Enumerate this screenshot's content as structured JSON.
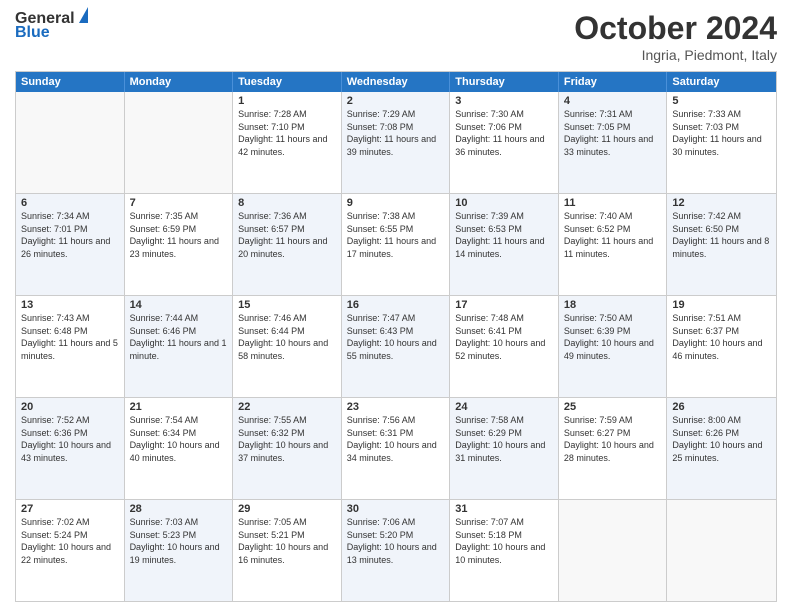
{
  "header": {
    "logo_line1": "General",
    "logo_line2": "Blue",
    "title": "October 2024",
    "subtitle": "Ingria, Piedmont, Italy"
  },
  "calendar": {
    "days": [
      "Sunday",
      "Monday",
      "Tuesday",
      "Wednesday",
      "Thursday",
      "Friday",
      "Saturday"
    ],
    "weeks": [
      [
        {
          "day": "",
          "sunrise": "",
          "sunset": "",
          "daylight": "",
          "empty": true
        },
        {
          "day": "",
          "sunrise": "",
          "sunset": "",
          "daylight": "",
          "empty": true
        },
        {
          "day": "1",
          "sunrise": "Sunrise: 7:28 AM",
          "sunset": "Sunset: 7:10 PM",
          "daylight": "Daylight: 11 hours and 42 minutes.",
          "empty": false,
          "alt": false
        },
        {
          "day": "2",
          "sunrise": "Sunrise: 7:29 AM",
          "sunset": "Sunset: 7:08 PM",
          "daylight": "Daylight: 11 hours and 39 minutes.",
          "empty": false,
          "alt": true
        },
        {
          "day": "3",
          "sunrise": "Sunrise: 7:30 AM",
          "sunset": "Sunset: 7:06 PM",
          "daylight": "Daylight: 11 hours and 36 minutes.",
          "empty": false,
          "alt": false
        },
        {
          "day": "4",
          "sunrise": "Sunrise: 7:31 AM",
          "sunset": "Sunset: 7:05 PM",
          "daylight": "Daylight: 11 hours and 33 minutes.",
          "empty": false,
          "alt": true
        },
        {
          "day": "5",
          "sunrise": "Sunrise: 7:33 AM",
          "sunset": "Sunset: 7:03 PM",
          "daylight": "Daylight: 11 hours and 30 minutes.",
          "empty": false,
          "alt": false
        }
      ],
      [
        {
          "day": "6",
          "sunrise": "Sunrise: 7:34 AM",
          "sunset": "Sunset: 7:01 PM",
          "daylight": "Daylight: 11 hours and 26 minutes.",
          "empty": false,
          "alt": true
        },
        {
          "day": "7",
          "sunrise": "Sunrise: 7:35 AM",
          "sunset": "Sunset: 6:59 PM",
          "daylight": "Daylight: 11 hours and 23 minutes.",
          "empty": false,
          "alt": false
        },
        {
          "day": "8",
          "sunrise": "Sunrise: 7:36 AM",
          "sunset": "Sunset: 6:57 PM",
          "daylight": "Daylight: 11 hours and 20 minutes.",
          "empty": false,
          "alt": true
        },
        {
          "day": "9",
          "sunrise": "Sunrise: 7:38 AM",
          "sunset": "Sunset: 6:55 PM",
          "daylight": "Daylight: 11 hours and 17 minutes.",
          "empty": false,
          "alt": false
        },
        {
          "day": "10",
          "sunrise": "Sunrise: 7:39 AM",
          "sunset": "Sunset: 6:53 PM",
          "daylight": "Daylight: 11 hours and 14 minutes.",
          "empty": false,
          "alt": true
        },
        {
          "day": "11",
          "sunrise": "Sunrise: 7:40 AM",
          "sunset": "Sunset: 6:52 PM",
          "daylight": "Daylight: 11 hours and 11 minutes.",
          "empty": false,
          "alt": false
        },
        {
          "day": "12",
          "sunrise": "Sunrise: 7:42 AM",
          "sunset": "Sunset: 6:50 PM",
          "daylight": "Daylight: 11 hours and 8 minutes.",
          "empty": false,
          "alt": true
        }
      ],
      [
        {
          "day": "13",
          "sunrise": "Sunrise: 7:43 AM",
          "sunset": "Sunset: 6:48 PM",
          "daylight": "Daylight: 11 hours and 5 minutes.",
          "empty": false,
          "alt": false
        },
        {
          "day": "14",
          "sunrise": "Sunrise: 7:44 AM",
          "sunset": "Sunset: 6:46 PM",
          "daylight": "Daylight: 11 hours and 1 minute.",
          "empty": false,
          "alt": true
        },
        {
          "day": "15",
          "sunrise": "Sunrise: 7:46 AM",
          "sunset": "Sunset: 6:44 PM",
          "daylight": "Daylight: 10 hours and 58 minutes.",
          "empty": false,
          "alt": false
        },
        {
          "day": "16",
          "sunrise": "Sunrise: 7:47 AM",
          "sunset": "Sunset: 6:43 PM",
          "daylight": "Daylight: 10 hours and 55 minutes.",
          "empty": false,
          "alt": true
        },
        {
          "day": "17",
          "sunrise": "Sunrise: 7:48 AM",
          "sunset": "Sunset: 6:41 PM",
          "daylight": "Daylight: 10 hours and 52 minutes.",
          "empty": false,
          "alt": false
        },
        {
          "day": "18",
          "sunrise": "Sunrise: 7:50 AM",
          "sunset": "Sunset: 6:39 PM",
          "daylight": "Daylight: 10 hours and 49 minutes.",
          "empty": false,
          "alt": true
        },
        {
          "day": "19",
          "sunrise": "Sunrise: 7:51 AM",
          "sunset": "Sunset: 6:37 PM",
          "daylight": "Daylight: 10 hours and 46 minutes.",
          "empty": false,
          "alt": false
        }
      ],
      [
        {
          "day": "20",
          "sunrise": "Sunrise: 7:52 AM",
          "sunset": "Sunset: 6:36 PM",
          "daylight": "Daylight: 10 hours and 43 minutes.",
          "empty": false,
          "alt": true
        },
        {
          "day": "21",
          "sunrise": "Sunrise: 7:54 AM",
          "sunset": "Sunset: 6:34 PM",
          "daylight": "Daylight: 10 hours and 40 minutes.",
          "empty": false,
          "alt": false
        },
        {
          "day": "22",
          "sunrise": "Sunrise: 7:55 AM",
          "sunset": "Sunset: 6:32 PM",
          "daylight": "Daylight: 10 hours and 37 minutes.",
          "empty": false,
          "alt": true
        },
        {
          "day": "23",
          "sunrise": "Sunrise: 7:56 AM",
          "sunset": "Sunset: 6:31 PM",
          "daylight": "Daylight: 10 hours and 34 minutes.",
          "empty": false,
          "alt": false
        },
        {
          "day": "24",
          "sunrise": "Sunrise: 7:58 AM",
          "sunset": "Sunset: 6:29 PM",
          "daylight": "Daylight: 10 hours and 31 minutes.",
          "empty": false,
          "alt": true
        },
        {
          "day": "25",
          "sunrise": "Sunrise: 7:59 AM",
          "sunset": "Sunset: 6:27 PM",
          "daylight": "Daylight: 10 hours and 28 minutes.",
          "empty": false,
          "alt": false
        },
        {
          "day": "26",
          "sunrise": "Sunrise: 8:00 AM",
          "sunset": "Sunset: 6:26 PM",
          "daylight": "Daylight: 10 hours and 25 minutes.",
          "empty": false,
          "alt": true
        }
      ],
      [
        {
          "day": "27",
          "sunrise": "Sunrise: 7:02 AM",
          "sunset": "Sunset: 5:24 PM",
          "daylight": "Daylight: 10 hours and 22 minutes.",
          "empty": false,
          "alt": false
        },
        {
          "day": "28",
          "sunrise": "Sunrise: 7:03 AM",
          "sunset": "Sunset: 5:23 PM",
          "daylight": "Daylight: 10 hours and 19 minutes.",
          "empty": false,
          "alt": true
        },
        {
          "day": "29",
          "sunrise": "Sunrise: 7:05 AM",
          "sunset": "Sunset: 5:21 PM",
          "daylight": "Daylight: 10 hours and 16 minutes.",
          "empty": false,
          "alt": false
        },
        {
          "day": "30",
          "sunrise": "Sunrise: 7:06 AM",
          "sunset": "Sunset: 5:20 PM",
          "daylight": "Daylight: 10 hours and 13 minutes.",
          "empty": false,
          "alt": true
        },
        {
          "day": "31",
          "sunrise": "Sunrise: 7:07 AM",
          "sunset": "Sunset: 5:18 PM",
          "daylight": "Daylight: 10 hours and 10 minutes.",
          "empty": false,
          "alt": false
        },
        {
          "day": "",
          "sunrise": "",
          "sunset": "",
          "daylight": "",
          "empty": true
        },
        {
          "day": "",
          "sunrise": "",
          "sunset": "",
          "daylight": "",
          "empty": true
        }
      ]
    ]
  }
}
